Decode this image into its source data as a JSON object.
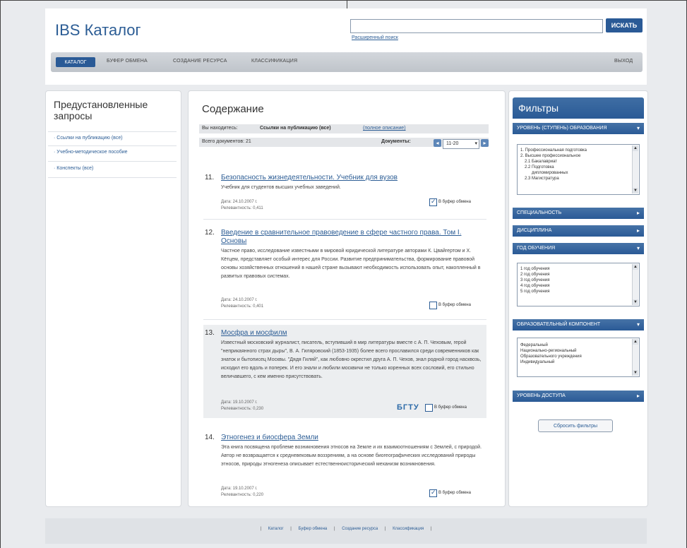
{
  "header": {
    "logo": "IBS Каталог",
    "search_button": "ИСКАТЬ",
    "advanced_search": "Расширенный поиск"
  },
  "nav": {
    "items": [
      "КАТАЛОГ",
      "БУФЕР ОБМЕНА",
      "СОЗДАНИЕ РЕСУРСА",
      "КЛАССИФИКАЦИЯ"
    ],
    "logout": "ВЫХОД",
    "active": "КАТАЛОГ"
  },
  "left": {
    "title": "Предустановленные запросы",
    "items": [
      "Ссылки на публикацию (все)",
      "Учебно-методическое пособие",
      "Конспекты (все)"
    ]
  },
  "main": {
    "title": "Содержание",
    "filter_label": "Вы находитесь: ",
    "filter_value": "Ссылки на публикацию (все)",
    "filter_link": "(полное описание)",
    "total_label": "Всего документов: 21",
    "docs_label": "Документы:",
    "docs_range": "11-20",
    "items": [
      {
        "num": "11.",
        "title": "Безопасность жизнедеятельности. Учебник для вузов",
        "desc": "Учебник для студентов высших учебных заведений.",
        "date": "Дата: 24.10.2007 г.",
        "rel": "Релевантность: 0,411",
        "clip": "В буфер обмена",
        "checked": true
      },
      {
        "num": "12.",
        "title": "Введение в сравнительное правоведение в сфере частного права. Том I. Основы",
        "desc": "Частное право, исследование известными в мировой юридической литературе авторами К. Цвайгертом и Х. Кётцем, представляет особый интерес для России. Развитие предпринимательства, формирование правовой основы хозяйственных отношений в нашей стране вызывают необходимость использовать опыт, накопленный в развитых правовых системах.",
        "date": "Дата: 24.10.2007 г.",
        "rel": "Релевантность: 0,401",
        "clip": "В буфер обмена",
        "checked": false
      },
      {
        "num": "13.",
        "title": "Мосфра и мосфилм",
        "desc": "Известный московский журналист, писатель, вступивший в мир литературы вместе с А. П. Чеховым, герой \"неприкаянного страх дыры\", В. А. Гиляровский (1853-1935) более всего прославился среди современников как знаток и бытописец Москвы. \"Дядя Гиляй\", как любовно окрестил друга А. П. Чехов, знал родной город насквозь, исходил его вдоль и поперек. И его знали и любили москвичи не только коренных всех сословий, его стильно величавшего, с кем именно присутствовать.",
        "date": "Дата: 19.10.2007 г.",
        "rel": "Релевантность: 0,230",
        "clip": "В буфер обмена",
        "checked": false,
        "badge": "БГТУ"
      },
      {
        "num": "14.",
        "title": "Этногенез и биосфера Земли",
        "desc": "Эта книга посвящена проблеме возникновения этносов на Земле и их взаимоотношениям с Землей, с природой. Автор не возвращается к средневековым воззрениям, а на основе биогеографических исследований природы этносов, природы этногенеза описывает естественноисторический механизм возникновения.",
        "date": "Дата: 19.10.2007 г.",
        "rel": "Релевантность: 0,220",
        "clip": "В буфер обмена",
        "checked": true
      }
    ]
  },
  "filters": {
    "title": "Фильтры",
    "facets": [
      {
        "label": "УРОВЕНЬ (СТУПЕНЬ) ОБРАЗОВАНИЯ",
        "open": true,
        "options": [
          "1. Профессиональная подготовка",
          "2. Высшее профессиональное",
          "   2.1 Бакалавриат",
          "   2.2 Подготовка",
          "      дипломированных",
          "   2.3 Магистратура"
        ]
      },
      {
        "label": "СПЕЦИАЛЬНОСТЬ",
        "open": false,
        "options": []
      },
      {
        "label": "ДИСЦИПЛИНА",
        "open": false,
        "options": []
      },
      {
        "label": "ГОД ОБУЧЕНИЯ",
        "open": true,
        "options": [
          "1 год обучения",
          "2 год обучения",
          "3 год обучения",
          "4 год обучения",
          "5 год обучения"
        ]
      },
      {
        "label": "ОБРАЗОВАТЕЛЬНЫЙ КОМПОНЕНТ",
        "open": true,
        "options": [
          "Федеральный",
          "Национально-региональный",
          "Образовательного учреждения",
          "Индивидуальный"
        ]
      },
      {
        "label": "УРОВЕНЬ ДОСТУПА",
        "open": false,
        "options": []
      }
    ],
    "reset": "Сбросить фильтры"
  },
  "footer": {
    "links": [
      "Каталог",
      "Буфер обмена",
      "Создание ресурса",
      "Классификация"
    ]
  },
  "colors": {
    "brand": "#2a5a96",
    "link": "#2c5d95"
  }
}
